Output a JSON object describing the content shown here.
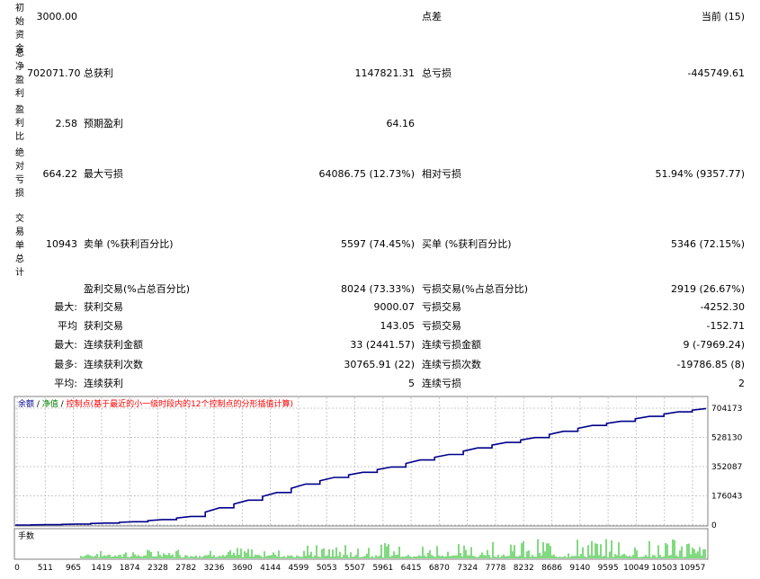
{
  "report": {
    "initial_deposit": {
      "label": "初始资金",
      "value": "3000.00"
    },
    "spread": {
      "label": "点差",
      "value": "当前 (15)"
    },
    "total_net_profit": {
      "label": "总净盈利",
      "value": "702071.70"
    },
    "gross_profit": {
      "label": "总获利",
      "value": "1147821.31"
    },
    "gross_loss": {
      "label": "总亏损",
      "value": "-445749.61"
    },
    "profit_factor": {
      "label": "盈利比",
      "value": "2.58"
    },
    "expected_payoff": {
      "label": "预期盈利",
      "value": "64.16"
    },
    "absolute_drawdown": {
      "label": "绝对亏损",
      "value": "664.22"
    },
    "maximal_drawdown": {
      "label": "最大亏损",
      "value": "64086.75 (12.73%)"
    },
    "relative_drawdown": {
      "label": "相对亏损",
      "value": "51.94% (9357.77)"
    },
    "total_trades": {
      "label": "交易单总计",
      "value": "10943"
    },
    "short_positions": {
      "label": "卖单 (%获利百分比)",
      "value": "5597 (74.45%)"
    },
    "long_positions": {
      "label": "买单 (%获利百分比)",
      "value": "5346 (72.15%)"
    },
    "profit_trades": {
      "label": "盈利交易(%占总百分比)",
      "value": "8024 (73.33%)"
    },
    "loss_trades": {
      "label": "亏损交易(%占总百分比)",
      "value": "2919 (26.67%)"
    },
    "largest": {
      "prefix": "最大:",
      "profit_label": "获利交易",
      "profit_value": "9000.07",
      "loss_label": "亏损交易",
      "loss_value": "-4252.30"
    },
    "average": {
      "prefix": "平均",
      "profit_label": "获利交易",
      "profit_value": "143.05",
      "loss_label": "亏损交易",
      "loss_value": "-152.71"
    },
    "max_consecutive": {
      "prefix": "最大:",
      "wins_label": "连续获利金额",
      "wins_value": "33 (2441.57)",
      "losses_label": "连续亏损金额",
      "losses_value": "9 (-7969.24)"
    },
    "maximal_consecutive": {
      "prefix": "最多:",
      "profit_label": "连续获利次数",
      "profit_value": "30765.91 (22)",
      "loss_label": "连续亏损次数",
      "loss_value": "-19786.85 (8)"
    },
    "average_consecutive": {
      "prefix": "平均:",
      "wins_label": "连续获利",
      "wins_value": "5",
      "losses_label": "连续亏损",
      "losses_value": "2"
    }
  },
  "chart": {
    "legend": {
      "balance": "余额",
      "sep1": " / ",
      "equity": "净值",
      "sep2": " / ",
      "control_points": "控制点(基于最近的小一级时段内的12个控制点的分形插值计算)"
    },
    "lot_label": "手数",
    "colors": {
      "balance": "#00008b",
      "equity": "#008000",
      "control": "#ff0000",
      "lots": "#00b400",
      "grid": "#c8c8c8"
    }
  },
  "chart_data": {
    "type": "line",
    "series": [
      {
        "name": "余额",
        "x": [
          0,
          511,
          965,
          1419,
          1874,
          2328,
          2782,
          3236,
          3690,
          4144,
          4599,
          5053,
          5507,
          5961,
          6415,
          6870,
          7324,
          7778,
          8232,
          8686,
          9140,
          9595,
          10049,
          10503,
          10943
        ],
        "values": [
          0,
          2000,
          6000,
          12000,
          20000,
          33000,
          52000,
          104000,
          150000,
          196000,
          247000,
          287000,
          318000,
          350000,
          392000,
          425000,
          465000,
          498000,
          527000,
          565000,
          600000,
          625000,
          655000,
          682000,
          702071.7
        ]
      }
    ],
    "x_ticks": [
      "0",
      "511",
      "965",
      "1419",
      "1874",
      "2328",
      "2782",
      "3236",
      "3690",
      "4144",
      "4599",
      "5053",
      "5507",
      "5961",
      "6415",
      "6870",
      "7324",
      "7778",
      "8232",
      "8686",
      "9140",
      "9595",
      "10049",
      "10503",
      "10957"
    ],
    "y_ticks": [
      "704173",
      "528130",
      "352087",
      "176043",
      "0"
    ],
    "ylim": [
      0,
      704173
    ],
    "xlim": [
      0,
      10957
    ],
    "grid": true,
    "lots_panel": {
      "label": "手数"
    }
  }
}
